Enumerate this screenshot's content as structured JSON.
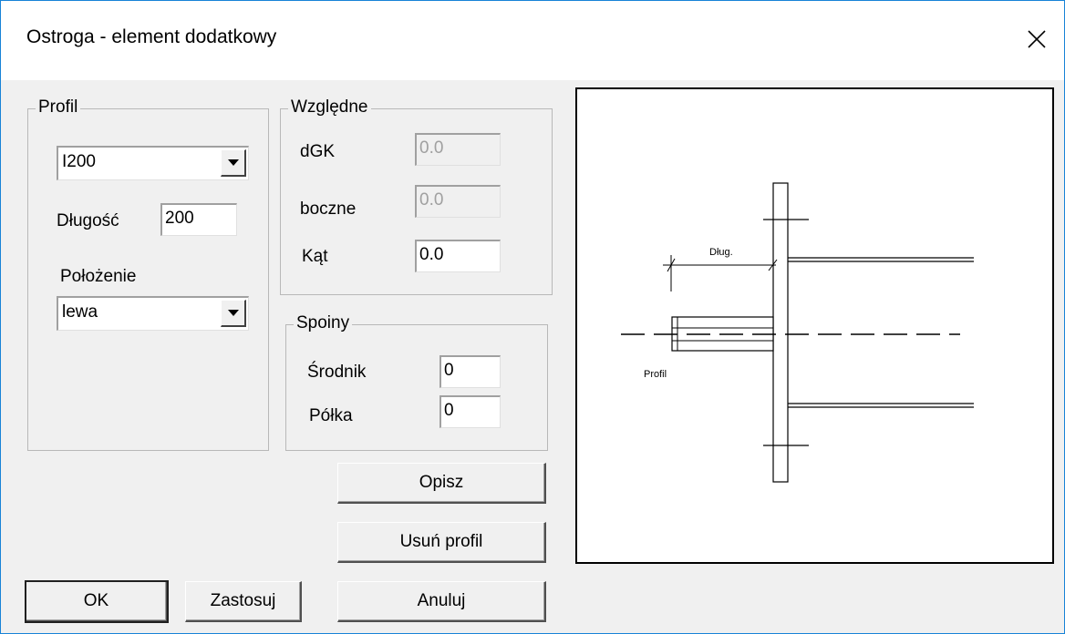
{
  "window": {
    "title": "Ostroga - element dodatkowy"
  },
  "profil_group": {
    "label": "Profil",
    "profile_value": "I200",
    "length_label": "Długość",
    "length_value": "200",
    "position_label": "Położenie",
    "position_value": "lewa"
  },
  "wzgledne_group": {
    "label": "Względne",
    "dgk_label": "dGK",
    "dgk_value": "0.0",
    "boczne_label": "boczne",
    "boczne_value": "0.0",
    "kat_label": "Kąt",
    "kat_value": "0.0"
  },
  "spoiny_group": {
    "label": "Spoiny",
    "srodnik_label": "Środnik",
    "srodnik_value": "0",
    "polka_label": "Półka",
    "polka_value": "0"
  },
  "buttons": {
    "opisz": "Opisz",
    "usun_profil": "Usuń profil",
    "ok": "OK",
    "zastosuj": "Zastosuj",
    "anuluj": "Anuluj"
  },
  "preview": {
    "dim_label": "Dług.",
    "profile_label": "Profil"
  },
  "icons": {
    "close": "close-icon",
    "dropdown": "chevron-down-icon"
  }
}
